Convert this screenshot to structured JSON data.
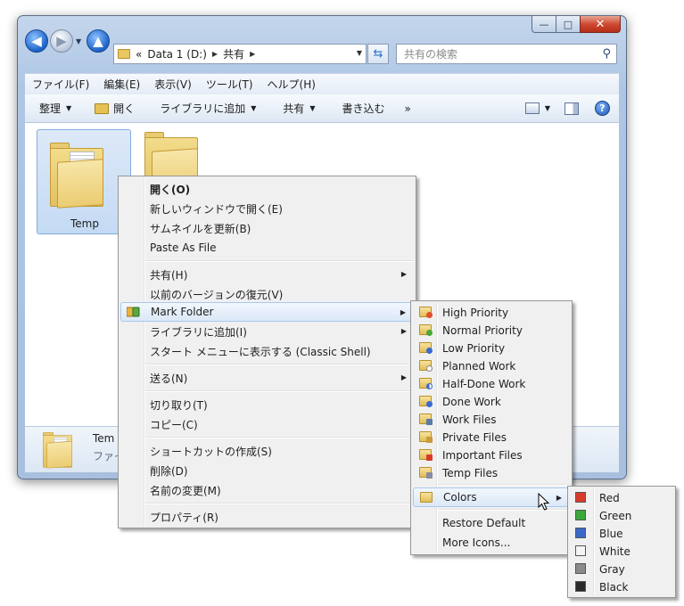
{
  "window": {
    "caption": {
      "minimize": "—",
      "maximize": "□",
      "close": "✕"
    }
  },
  "address": {
    "overflow": "«",
    "segments": [
      "Data 1 (D:)",
      "共有"
    ],
    "search_placeholder": "共有の検索"
  },
  "menubar": [
    "ファイル(F)",
    "編集(E)",
    "表示(V)",
    "ツール(T)",
    "ヘルプ(H)"
  ],
  "toolbar": {
    "organize": "整理",
    "open": "開く",
    "add_to_library": "ライブラリに追加",
    "share": "共有",
    "burn": "書き込む",
    "more": "»"
  },
  "folders": [
    {
      "label": "Temp"
    },
    {
      "label": ""
    }
  ],
  "details": {
    "name": "Tem",
    "type": "ファイ"
  },
  "context_menu": {
    "open": "開く(O)",
    "open_new_window": "新しいウィンドウで開く(E)",
    "update_thumbnail": "サムネイルを更新(B)",
    "paste_as_file": "Paste As File",
    "share": "共有(H)",
    "restore_previous": "以前のバージョンの復元(V)",
    "mark_folder": "Mark Folder",
    "add_to_library": "ライブラリに追加(I)",
    "show_in_start_menu": "スタート メニューに表示する (Classic Shell)",
    "send_to": "送る(N)",
    "cut": "切り取り(T)",
    "copy": "コピー(C)",
    "create_shortcut": "ショートカットの作成(S)",
    "delete": "削除(D)",
    "rename": "名前の変更(M)",
    "properties": "プロパティ(R)"
  },
  "mark_folder_menu": {
    "high_priority": "High Priority",
    "normal_priority": "Normal Priority",
    "low_priority": "Low Priority",
    "planned_work": "Planned Work",
    "half_done_work": "Half-Done Work",
    "done_work": "Done Work",
    "work_files": "Work Files",
    "private_files": "Private Files",
    "important_files": "Important Files",
    "temp_files": "Temp Files",
    "colors": "Colors",
    "restore_default": "Restore Default",
    "more_icons": "More Icons..."
  },
  "colors_menu": {
    "red": "Red",
    "green": "Green",
    "blue": "Blue",
    "white": "White",
    "gray": "Gray",
    "black": "Black"
  },
  "swatch_colors": {
    "red": "#d83a2a",
    "green": "#3aa83a",
    "blue": "#3a68c8",
    "white": "#f4f4f4",
    "gray": "#8a8a8a",
    "black": "#2a2a2a"
  }
}
